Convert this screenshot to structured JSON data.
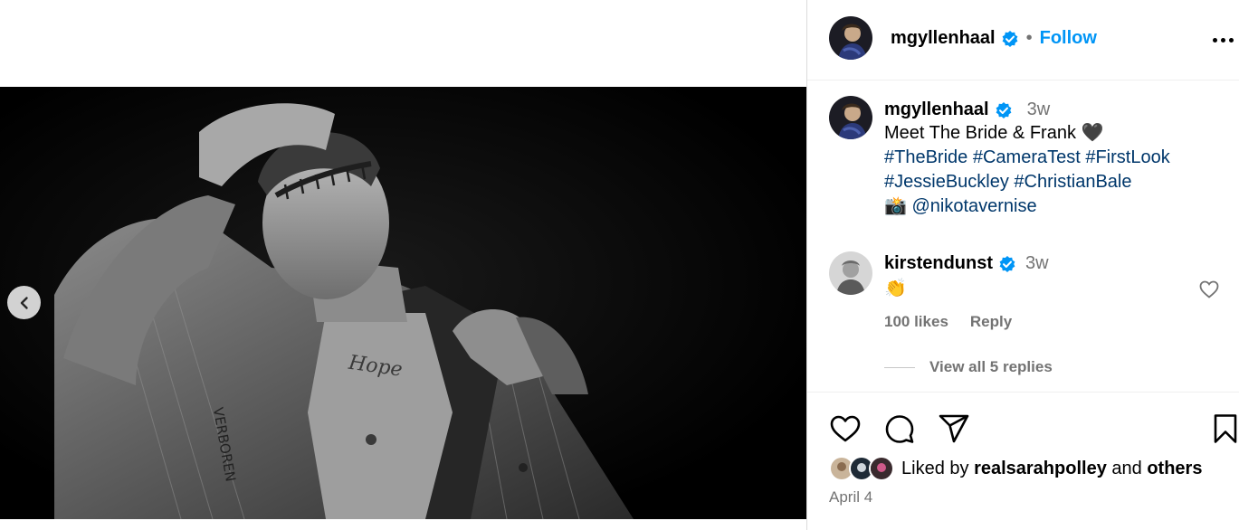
{
  "post": {
    "author": "mgyllenhaal",
    "follow_label": "Follow",
    "separator": "•",
    "media_alt": "Black and white photo of a man in Frankenstein-style makeup with stitched forehead, holding open his shirt to show a tattoo"
  },
  "caption": {
    "username": "mgyllenhaal",
    "time": "3w",
    "line1": "Meet The Bride & Frank 🖤",
    "hashtags_line1": [
      "#TheBride",
      "#CameraTest",
      "#FirstLook"
    ],
    "hashtags_line2": [
      "#JessieBuckley",
      "#ChristianBale"
    ],
    "camera_emoji": "📸",
    "mention": "@nikotavernise"
  },
  "comment": {
    "username": "kirstendunst",
    "time": "3w",
    "text": "👏",
    "likes": "100 likes",
    "reply_label": "Reply",
    "view_replies": "View all 5 replies"
  },
  "footer": {
    "liked_by_prefix": "Liked by",
    "liked_by_user": "realsarahpolley",
    "liked_by_and": "and",
    "liked_by_others": "others",
    "date": "April 4"
  },
  "colors": {
    "link": "#0095f6",
    "hashtag": "#00376b",
    "secondary": "#737373",
    "verified": "#0095f6"
  }
}
